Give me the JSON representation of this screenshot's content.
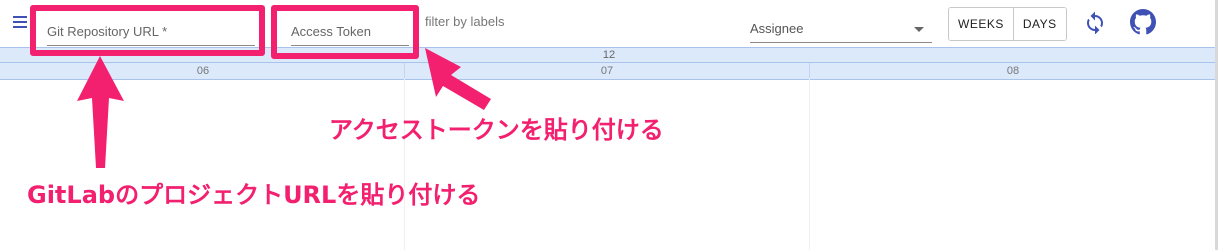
{
  "toolbar": {
    "repo_url_placeholder": "Git Repository URL *",
    "access_token_placeholder": "Access Token",
    "filter_text": "filter by labels",
    "assignee_label": "Assignee",
    "weeks_label": "WEEKS",
    "days_label": "DAYS",
    "icons": {
      "menu": "hamburger-menu-icon",
      "refresh": "refresh-icon",
      "github": "github-icon"
    }
  },
  "timeline": {
    "month": "12",
    "days": [
      "06",
      "07",
      "08"
    ]
  },
  "annotations": {
    "token_caption": "アクセストークンを貼り付ける",
    "url_caption": "GitLabのプロジェクトURLを貼り付ける"
  },
  "colors": {
    "accent": "#3f51b5",
    "annotation": "#f2206f",
    "timeline_bg": "#dbe9fb",
    "timeline_border": "#a9c4ec"
  }
}
